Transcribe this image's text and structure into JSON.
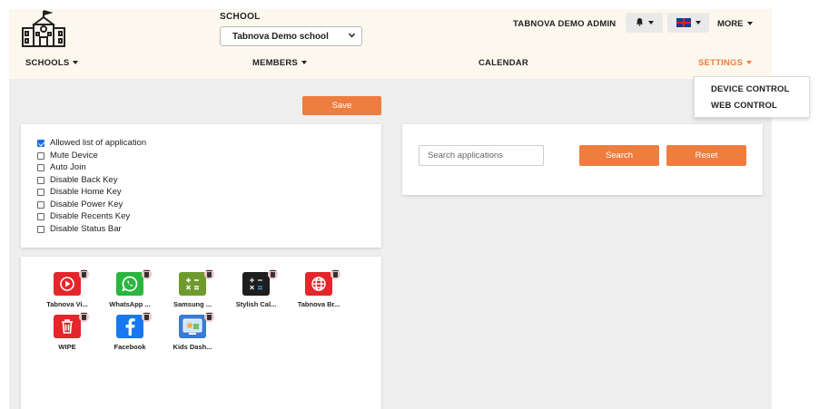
{
  "header": {
    "school_label": "SCHOOL",
    "school_select_value": "Tabnova Demo school",
    "admin_name": "TABNOVA DEMO ADMIN",
    "more_label": "MORE",
    "bell_icon": "bell-icon",
    "flag_icon": "uk-flag-icon",
    "logo_icon": "school-building-icon"
  },
  "nav": {
    "schools": "SCHOOLS",
    "members": "MEMBERS",
    "calendar": "CALENDAR",
    "settings": "SETTINGS"
  },
  "settings_menu": {
    "items": [
      "DEVICE CONTROL",
      "WEB CONTROL"
    ]
  },
  "toolbar": {
    "save_label": "Save"
  },
  "options": [
    {
      "label": "Allowed list of application",
      "checked": true
    },
    {
      "label": "Mute Device",
      "checked": false
    },
    {
      "label": "Auto Join",
      "checked": false
    },
    {
      "label": "Disable Back Key",
      "checked": false
    },
    {
      "label": "Disable Home Key",
      "checked": false
    },
    {
      "label": "Disable Power Key",
      "checked": false
    },
    {
      "label": "Disable Recents Key",
      "checked": false
    },
    {
      "label": "Disable Status Bar",
      "checked": false
    }
  ],
  "search": {
    "placeholder": "Search applications",
    "search_label": "Search",
    "reset_label": "Reset"
  },
  "apps": [
    {
      "label": "Tabnova Vi...",
      "icon": "video-play-icon"
    },
    {
      "label": "WhatsApp ...",
      "icon": "whatsapp-icon"
    },
    {
      "label": "Samsung ...",
      "icon": "calculator-icon"
    },
    {
      "label": "Stylish Cal...",
      "icon": "calculator-dark-icon"
    },
    {
      "label": "Tabnova Br...",
      "icon": "browser-globe-icon"
    },
    {
      "label": "WIPE",
      "icon": "trash-wipe-icon"
    },
    {
      "label": "Facebook",
      "icon": "facebook-icon"
    },
    {
      "label": "Kids Dash...",
      "icon": "kids-dashboard-icon"
    }
  ],
  "colors": {
    "accent": "#ee7d40",
    "header_bg": "#fdf8ee",
    "content_bg": "#eeeeee",
    "checkbox_on": "#1a6fe0"
  }
}
